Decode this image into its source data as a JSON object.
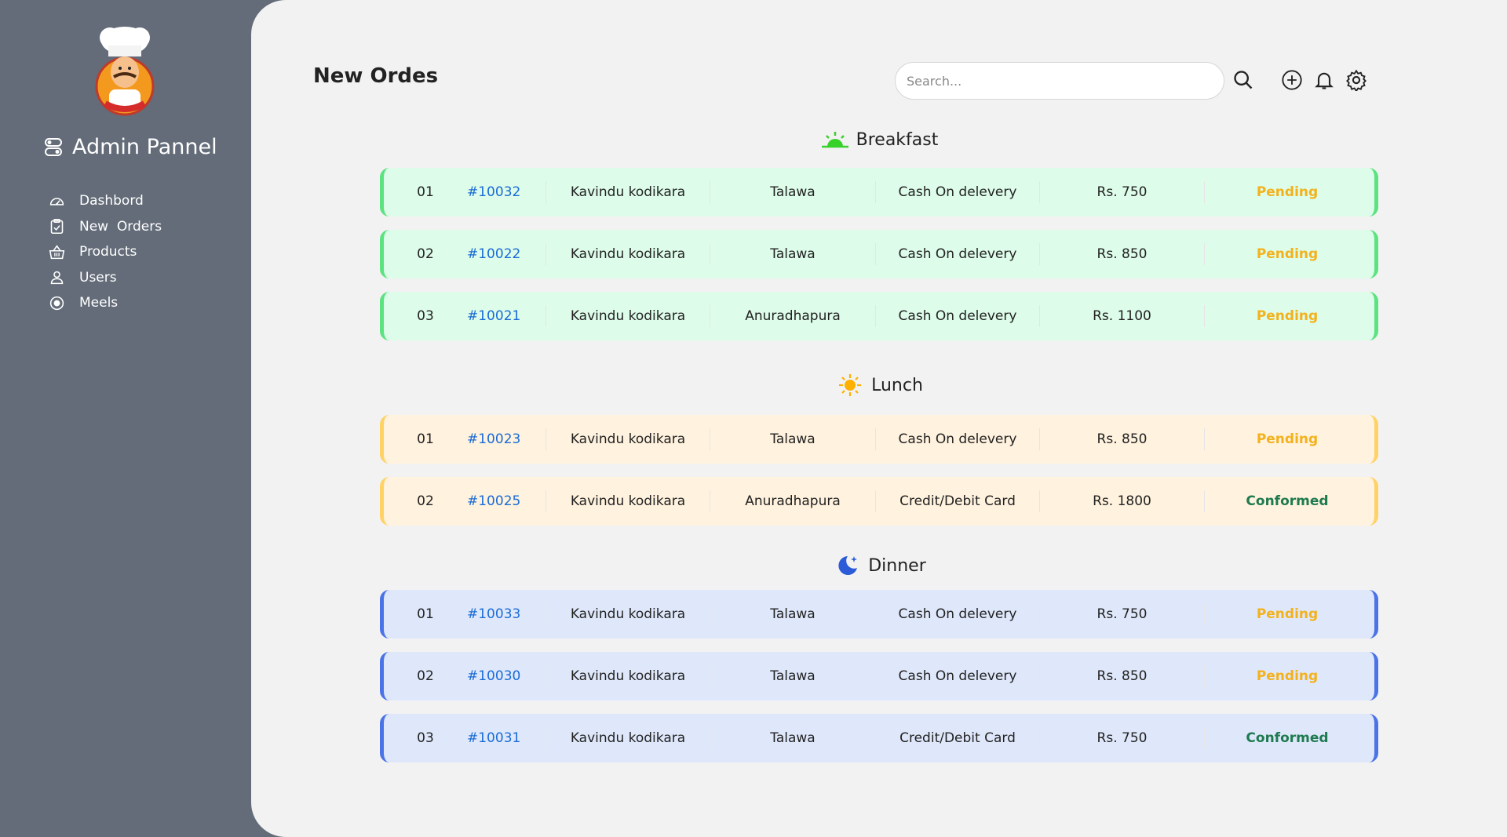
{
  "sidebar": {
    "logo_icon": "chef-logo",
    "title": "Admin Pannel",
    "items": [
      {
        "label": "Dashbord",
        "icon": "speedometer-icon"
      },
      {
        "label": "New  Orders",
        "icon": "clipboard-check-icon"
      },
      {
        "label": "Products",
        "icon": "basket-icon"
      },
      {
        "label": "Users",
        "icon": "user-icon"
      },
      {
        "label": "Meels",
        "icon": "meal-icon"
      }
    ]
  },
  "header": {
    "title": "New Ordes",
    "search_placeholder": "Search...",
    "icons": [
      "search-icon",
      "add-circle-icon",
      "bell-icon",
      "gear-icon"
    ]
  },
  "sections": [
    {
      "title": "Breakfast",
      "icon": "sunrise-icon",
      "color": "#5be37f",
      "orders": [
        {
          "no": "01",
          "id": "#10032",
          "name": "Kavindu kodikara",
          "city": "Talawa",
          "payment": "Cash On delevery",
          "price": "Rs. 750",
          "status": "Pending"
        },
        {
          "no": "02",
          "id": "#10022",
          "name": "Kavindu kodikara",
          "city": "Talawa",
          "payment": "Cash On delevery",
          "price": "Rs. 850",
          "status": "Pending"
        },
        {
          "no": "03",
          "id": "#10021",
          "name": "Kavindu kodikara",
          "city": "Anuradhapura",
          "payment": "Cash On delevery",
          "price": "Rs. 1100",
          "status": "Pending"
        }
      ]
    },
    {
      "title": "Lunch",
      "icon": "sun-icon",
      "color": "#ffd266",
      "orders": [
        {
          "no": "01",
          "id": "#10023",
          "name": "Kavindu kodikara",
          "city": "Talawa",
          "payment": "Cash On delevery",
          "price": "Rs. 850",
          "status": "Pending"
        },
        {
          "no": "02",
          "id": "#10025",
          "name": "Kavindu kodikara",
          "city": "Anuradhapura",
          "payment": "Credit/Debit Card",
          "price": "Rs. 1800",
          "status": "Conformed"
        }
      ]
    },
    {
      "title": "Dinner",
      "icon": "moon-icon",
      "color": "#4a73e8",
      "orders": [
        {
          "no": "01",
          "id": "#10033",
          "name": "Kavindu kodikara",
          "city": "Talawa",
          "payment": "Cash On delevery",
          "price": "Rs. 750",
          "status": "Pending"
        },
        {
          "no": "02",
          "id": "#10030",
          "name": "Kavindu kodikara",
          "city": "Talawa",
          "payment": "Cash On delevery",
          "price": "Rs. 850",
          "status": "Pending"
        },
        {
          "no": "03",
          "id": "#10031",
          "name": "Kavindu kodikara",
          "city": "Talawa",
          "payment": "Credit/Debit Card",
          "price": "Rs. 750",
          "status": "Conformed"
        }
      ]
    }
  ],
  "colors": {
    "sidebar_bg": "#636c78",
    "main_bg": "#f2f2f2",
    "link": "#1a6bd6",
    "pending": "#f3b21c",
    "conformed": "#1e7a4f"
  }
}
